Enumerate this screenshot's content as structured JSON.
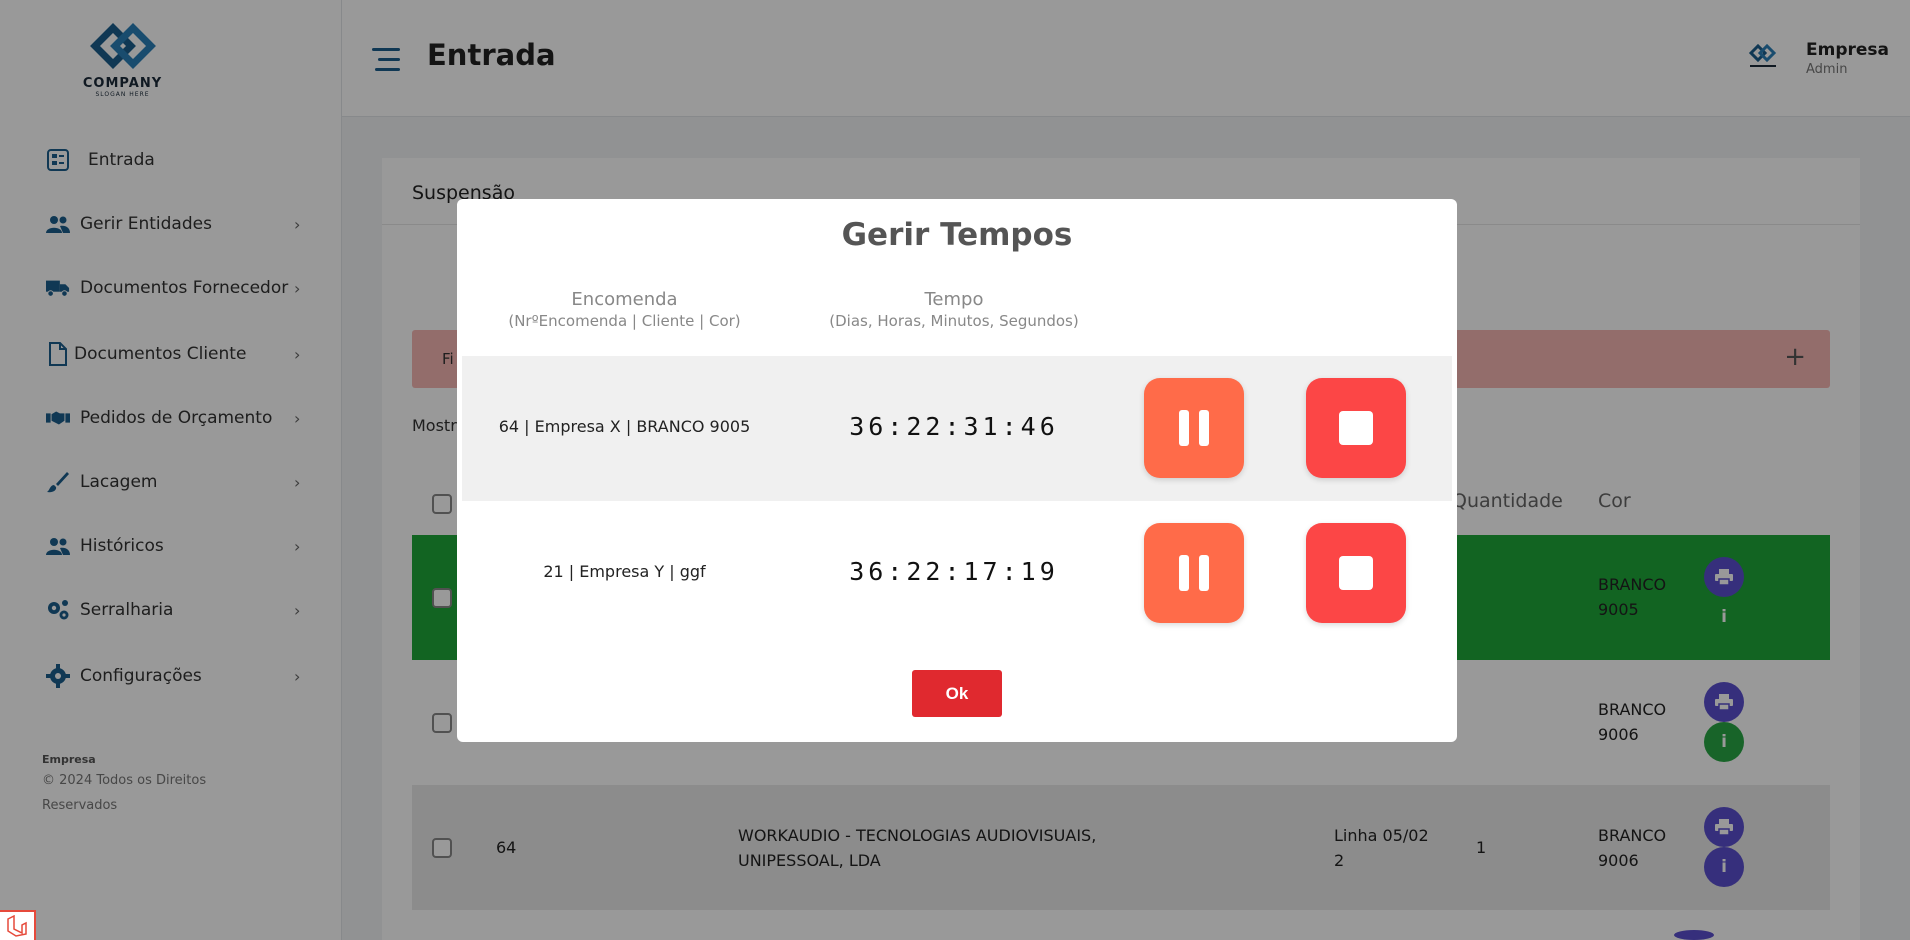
{
  "brand": {
    "logo_text": "COMPANY",
    "slogan": "SLOGAN HERE",
    "primary_color": "#1b5e8c"
  },
  "header": {
    "title": "Entrada",
    "user_name": "Empresa",
    "user_role": "Admin"
  },
  "sidebar": {
    "items": [
      {
        "label": "Entrada",
        "icon": "dashboard-icon",
        "chevron": false
      },
      {
        "label": "Gerir Entidades",
        "icon": "users-icon",
        "chevron": true
      },
      {
        "label": "Documentos Fornecedor",
        "icon": "truck-icon",
        "chevron": true
      },
      {
        "label": "Documentos Cliente",
        "icon": "document-icon",
        "chevron": true
      },
      {
        "label": "Pedidos de Orçamento",
        "icon": "handshake-icon",
        "chevron": true
      },
      {
        "label": "Lacagem",
        "icon": "brush-icon",
        "chevron": true
      },
      {
        "label": "Históricos",
        "icon": "users-icon",
        "chevron": true
      },
      {
        "label": "Serralharia",
        "icon": "cogs-icon",
        "chevron": true
      },
      {
        "label": "Configurações",
        "icon": "gear-icon",
        "chevron": true
      }
    ],
    "footer_company": "Empresa",
    "footer_rights": "© 2024 Todos os Direitos Reservados"
  },
  "main": {
    "card_title": "Suspensão",
    "filter_label": "Fi",
    "filter_plus": "+",
    "show_label": "Mostr",
    "columns": {
      "quantity": "Quantidade",
      "color": "Cor"
    },
    "rows": [
      {
        "number": "",
        "client": "",
        "line": "",
        "quantity": "",
        "color": "BRANCO 9005",
        "style": "green",
        "info_style": "plain"
      },
      {
        "number": "",
        "client": "",
        "line": "",
        "quantity": "",
        "color": "BRANCO 9006",
        "style": "white",
        "info_style": "green"
      },
      {
        "number": "64",
        "client": "WORKAUDIO - TECNOLOGIAS AUDIOVISUAIS, UNIPESSOAL, LDA",
        "line": "Linha 05/02 2",
        "quantity": "1",
        "color": "BRANCO 9006",
        "style": "grey",
        "info_style": "purple"
      }
    ],
    "info_glyph": "i"
  },
  "modal": {
    "title": "Gerir Tempos",
    "col_order": "Encomenda",
    "col_order_sub": "(NrºEncomenda | Cliente | Cor)",
    "col_time": "Tempo",
    "col_time_sub": "(Dias, Horas, Minutos, Segundos)",
    "timers": [
      {
        "order": "64 | Empresa X | BRANCO 9005",
        "time": "36:22:31:46"
      },
      {
        "order": "21 | Empresa Y | ggf",
        "time": "36:22:17:19"
      }
    ],
    "ok_label": "Ok",
    "pause_color": "#ff6b49",
    "stop_color": "#fc4646"
  }
}
